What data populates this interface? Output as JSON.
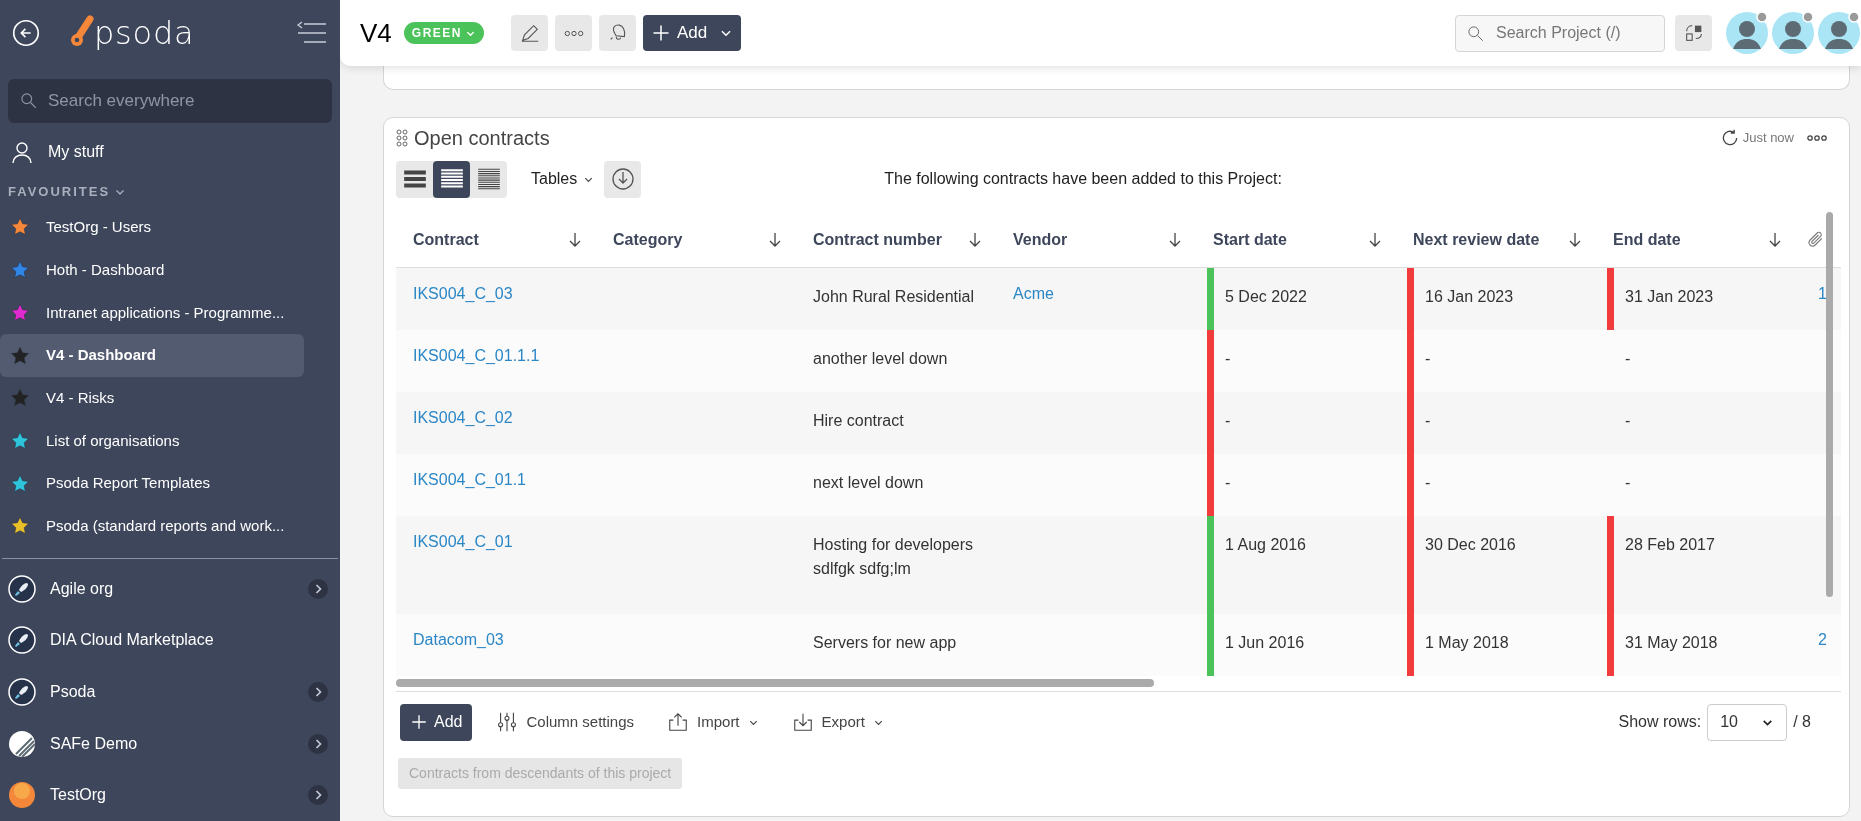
{
  "sidebar": {
    "logo_text": "psoda",
    "search": {
      "placeholder": "Search everywhere"
    },
    "my_stuff": "My stuff",
    "favourites_heading": "FAVOURITES",
    "favourites": [
      {
        "label": "TestOrg - Users",
        "color": "#f5873a",
        "selected": false
      },
      {
        "label": "Hoth - Dashboard",
        "color": "#2f86e6",
        "selected": false
      },
      {
        "label": "Intranet applications - Programme...",
        "color": "#e02ad0",
        "selected": false
      },
      {
        "label": "V4 - Dashboard",
        "color": "#222222",
        "selected": true
      },
      {
        "label": "V4 - Risks",
        "color": "#222222",
        "selected": false
      },
      {
        "label": "List of organisations",
        "color": "#2ec4dc",
        "selected": false
      },
      {
        "label": "Psoda Report Templates",
        "color": "#2ec4dc",
        "selected": false
      },
      {
        "label": "Psoda (standard reports and work...",
        "color": "#e8c02a",
        "selected": false
      }
    ],
    "organisations": [
      {
        "label": "Agile org",
        "kind": "rocket",
        "expandable": true
      },
      {
        "label": "DIA Cloud Marketplace",
        "kind": "rocket",
        "expandable": false
      },
      {
        "label": "Psoda",
        "kind": "rocket",
        "expandable": true
      },
      {
        "label": "SAFe Demo",
        "kind": "stripes",
        "expandable": true
      },
      {
        "label": "TestOrg",
        "kind": "sun",
        "expandable": true
      }
    ]
  },
  "top_bar": {
    "title": "V4",
    "status": "GREEN",
    "add_button": "Add",
    "search": {
      "placeholder": "Search Project (/)"
    }
  },
  "card": {
    "title": "Open contracts",
    "refreshed": "Just now",
    "view_modes": [
      {
        "kind": "large",
        "selected": false
      },
      {
        "kind": "medium",
        "selected": true
      },
      {
        "kind": "compact",
        "selected": false
      }
    ],
    "tables_menu": "Tables",
    "description": "The following contracts have been added to this Project:",
    "table": {
      "columns": [
        "Contract",
        "Category",
        "Contract number",
        "Vendor",
        "Start date",
        "Next review date",
        "End date"
      ],
      "rows": [
        {
          "contract": "IKS004_C_03",
          "contract_number": "John Rural Residential",
          "vendor": "Acme",
          "start": {
            "text": "5 Dec 2022",
            "color": "#4cc35a"
          },
          "next_review": {
            "text": "16 Jan 2023",
            "color": "#f03c3c"
          },
          "end": {
            "text": "31 Jan 2023",
            "color": "#f03c3c"
          },
          "attachments": "1"
        },
        {
          "contract": "IKS004_C_01.1.1",
          "contract_number": "another level down",
          "start": {
            "text": "-",
            "color": "#f03c3c"
          },
          "next_review": {
            "text": "-",
            "color": "#f03c3c"
          },
          "end": {
            "text": "-"
          }
        },
        {
          "contract": "IKS004_C_02",
          "contract_number": "Hire contract",
          "start": {
            "text": "-",
            "color": "#f03c3c"
          },
          "next_review": {
            "text": "-",
            "color": "#f03c3c"
          },
          "end": {
            "text": "-"
          }
        },
        {
          "contract": "IKS004_C_01.1",
          "contract_number": "next level down",
          "start": {
            "text": "-",
            "color": "#f03c3c"
          },
          "next_review": {
            "text": "-",
            "color": "#f03c3c"
          },
          "end": {
            "text": "-"
          }
        },
        {
          "contract": "IKS004_C_01",
          "contract_number": "Hosting for developers sdlfgk sdfg;lm",
          "start": {
            "text": "1 Aug 2016",
            "color": "#4cc35a"
          },
          "next_review": {
            "text": "30 Dec 2016",
            "color": "#f03c3c"
          },
          "end": {
            "text": "28 Feb 2017",
            "color": "#f03c3c"
          }
        },
        {
          "contract": "Datacom_03",
          "contract_number": "Servers for new app",
          "start": {
            "text": "1 Jun 2016",
            "color": "#4cc35a"
          },
          "next_review": {
            "text": "1 May 2018",
            "color": "#f03c3c"
          },
          "end": {
            "text": "31 May 2018",
            "color": "#f03c3c"
          },
          "attachments": "2"
        }
      ]
    },
    "footer": {
      "add_button": "Add",
      "column_settings": "Column settings",
      "import": "Import",
      "export": "Export",
      "show_rows_label": "Show rows:",
      "rows_per_page": "10",
      "total": "/ 8",
      "descendants_button": "Contracts from descendants of this project"
    }
  }
}
